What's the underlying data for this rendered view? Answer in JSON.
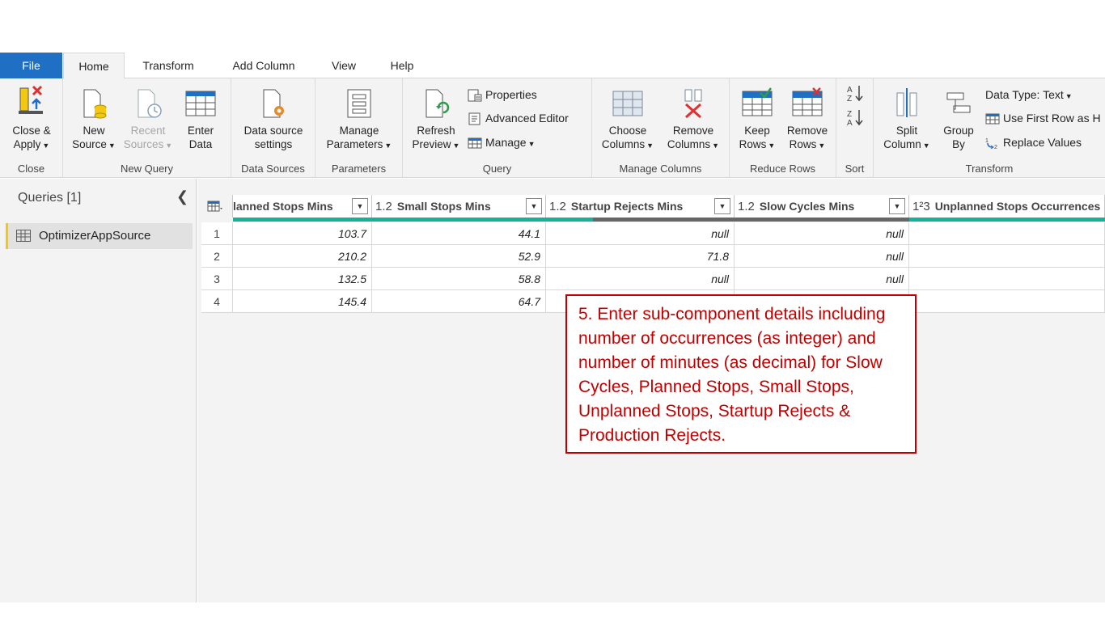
{
  "tabs": [
    {
      "label": "File"
    },
    {
      "label": "Home"
    },
    {
      "label": "Transform"
    },
    {
      "label": "Add Column"
    },
    {
      "label": "View"
    },
    {
      "label": "Help"
    }
  ],
  "ribbon": {
    "close": {
      "group": "Close",
      "close_apply": [
        "Close &",
        "Apply"
      ]
    },
    "new_query": {
      "group": "New Query",
      "new_source": [
        "New",
        "Source"
      ],
      "recent_sources": [
        "Recent",
        "Sources"
      ],
      "enter_data": [
        "Enter",
        "Data"
      ]
    },
    "data_sources": {
      "group": "Data Sources",
      "settings": [
        "Data source",
        "settings"
      ]
    },
    "parameters": {
      "group": "Parameters",
      "manage": [
        "Manage",
        "Parameters"
      ]
    },
    "query": {
      "group": "Query",
      "refresh": [
        "Refresh",
        "Preview"
      ],
      "properties": "Properties",
      "advanced_editor": "Advanced Editor",
      "manage": "Manage"
    },
    "manage_columns": {
      "group": "Manage Columns",
      "choose": [
        "Choose",
        "Columns"
      ],
      "remove": [
        "Remove",
        "Columns"
      ]
    },
    "reduce_rows": {
      "group": "Reduce Rows",
      "keep": [
        "Keep",
        "Rows"
      ],
      "remove": [
        "Remove",
        "Rows"
      ]
    },
    "sort": {
      "group": "Sort"
    },
    "transform": {
      "group": "Transform",
      "split": [
        "Split",
        "Column"
      ],
      "group_by": [
        "Group",
        "By"
      ],
      "data_type": "Data Type: Text",
      "first_row": "Use First Row as H",
      "replace": "Replace Values"
    }
  },
  "queries": {
    "title": "Queries [1]",
    "items": [
      {
        "name": "OptimizerAppSource"
      }
    ]
  },
  "grid": {
    "columns": [
      {
        "type": "",
        "name": "lanned Stops Mins"
      },
      {
        "type": "1.2",
        "name": "Small Stops Mins"
      },
      {
        "type": "1.2",
        "name": "Startup Rejects Mins"
      },
      {
        "type": "1.2",
        "name": "Slow Cycles Mins"
      },
      {
        "type": "1²3",
        "name": "Unplanned Stops Occurrences"
      }
    ],
    "rows": [
      {
        "n": "1",
        "c": [
          "103.7",
          "44.1",
          "null",
          "null",
          ""
        ]
      },
      {
        "n": "2",
        "c": [
          "210.2",
          "52.9",
          "71.8",
          "null",
          ""
        ]
      },
      {
        "n": "3",
        "c": [
          "132.5",
          "58.8",
          "null",
          "null",
          ""
        ]
      },
      {
        "n": "4",
        "c": [
          "145.4",
          "64.7",
          "",
          "",
          ""
        ]
      }
    ]
  },
  "callout": {
    "text": "5. Enter sub-component details including number of occurrences (as integer) and number of minutes (as decimal) for Slow Cycles, Planned Stops, Small Stops, Unplanned Stops, Startup Rejects &  Production Rejects."
  },
  "colors": {
    "file_tab": "#1f6fc5",
    "quality_green": "#1aaf9a",
    "quality_gray": "#666666",
    "callout_red": "#c00000",
    "query_marker": "#f2c811"
  }
}
